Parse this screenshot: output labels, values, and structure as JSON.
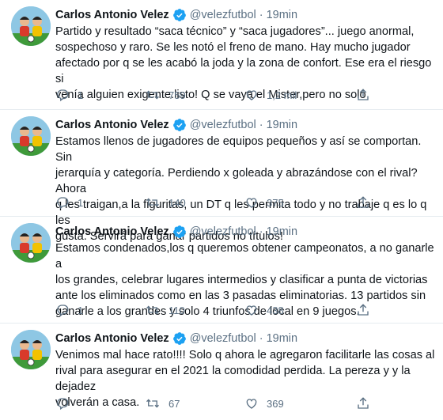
{
  "tweets": [
    {
      "name": "Carlos Antonio Velez",
      "handle": "@velezfutbol",
      "time": "19min",
      "text": "Partido y resultado “saca técnico” y “saca jugadores”... juego anormal,\nsospechoso y raro. Se les notó el freno de mano. Hay mucho jugador\nafectado por q se les acabó la joda y la zona de confort. Ese era el riesgo si\nvenía alguien exigente.listo! Q se vaya el Mister,pero no solo",
      "replies": "1",
      "retweets": "759",
      "likes": "1,2 mil"
    },
    {
      "name": "Carlos Antonio Velez",
      "handle": "@velezfutbol",
      "time": "19min",
      "text": "Estamos llenos de jugadores de equipos pequeños y así se comportan. Sin\njerarquía y categoría. Perdiendo x goleada y abrazándose con el rival?Ahora\nq les traigan,a la figuritas, un DT q les permita todo y no trabaje q es lo q les\ngusta. Servirá para ganar partidos no títulos!",
      "replies": "1",
      "retweets": "140",
      "likes": "375"
    },
    {
      "name": "Carlos Antonio Velez",
      "handle": "@velezfutbol",
      "time": "19min",
      "text": "Estamos condenados,los q queremos obtener campeonatos, a no ganarle a\nlos grandes, celebrar lugares intermedios y clasificar a punta de victorias\nante los eliminados como en las 3 pasadas eliminatorias. 13 partidos sin\nganarle a los grandes y solo 4 triunfos de local en 9 juegos.",
      "replies": "1",
      "retweets": "110",
      "likes": "438"
    },
    {
      "name": "Carlos Antonio Velez",
      "handle": "@velezfutbol",
      "time": "19min",
      "text": "Venimos mal hace rato!!!! Solo q ahora le agregaron facilitarle las cosas al\nrival para asegurar en el 2021 la comodidad perdida. La pereza y y la dejadez\nvolverán a casa.",
      "replies": "",
      "retweets": "67",
      "likes": "369"
    }
  ],
  "ui": {
    "dot": "·",
    "icons": [
      "reply-icon",
      "retweet-icon",
      "like-icon",
      "share-icon",
      "verified-badge-icon"
    ],
    "colors": {
      "text": "#0f1419",
      "muted": "#5b7083",
      "verified": "#1da1f2",
      "border": "#e6ecf0"
    }
  }
}
